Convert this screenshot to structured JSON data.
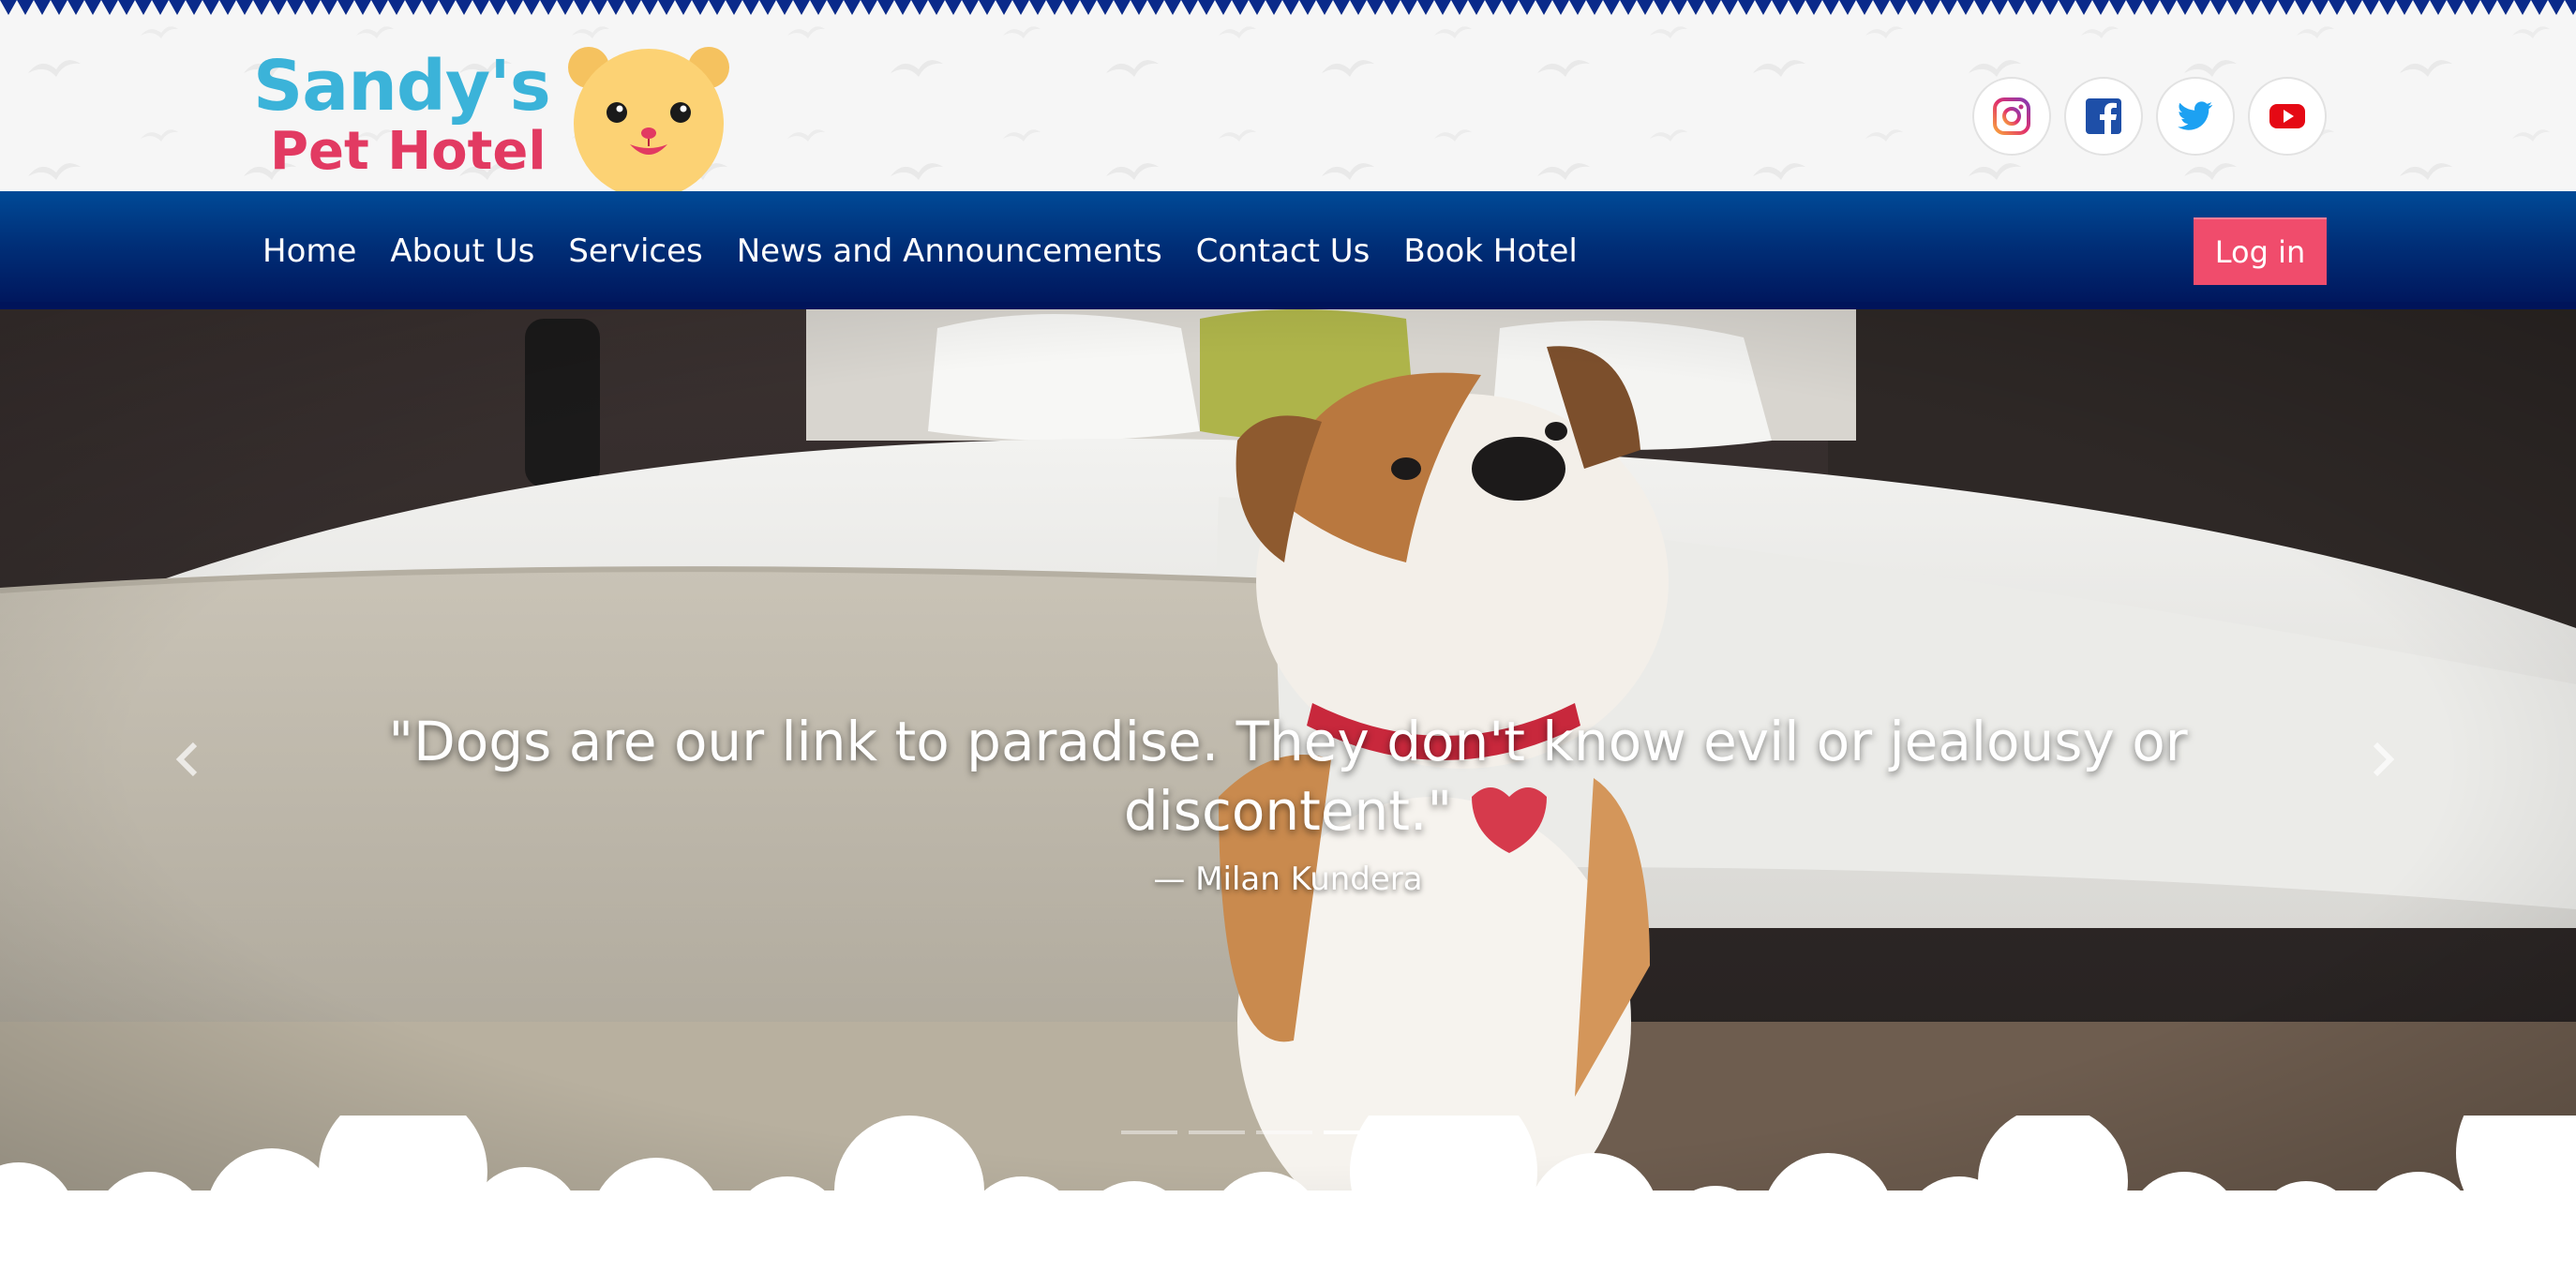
{
  "logo": {
    "line1": "Sandy's",
    "line2": "Pet Hotel"
  },
  "socials": [
    {
      "name": "instagram-icon",
      "color": "#c13584"
    },
    {
      "name": "facebook-icon",
      "color": "#1e4fa8"
    },
    {
      "name": "twitter-icon",
      "color": "#1da1f2"
    },
    {
      "name": "youtube-icon",
      "color": "#e50914"
    }
  ],
  "nav": {
    "items": [
      "Home",
      "About Us",
      "Services",
      "News and Announcements",
      "Contact Us",
      "Book Hotel"
    ],
    "login": "Log in"
  },
  "hero": {
    "quote": "\"Dogs are our link to paradise. They don't know evil or jealousy or discontent.\"",
    "author": "— Milan Kundera",
    "slides": 5,
    "active_slide": 4
  },
  "colors": {
    "nav_blue": "#002f78",
    "login_pink": "#f04c6c",
    "logo_blue": "#3bb3d9",
    "logo_pink": "#e23a62",
    "bear_yellow": "#fcd274"
  }
}
